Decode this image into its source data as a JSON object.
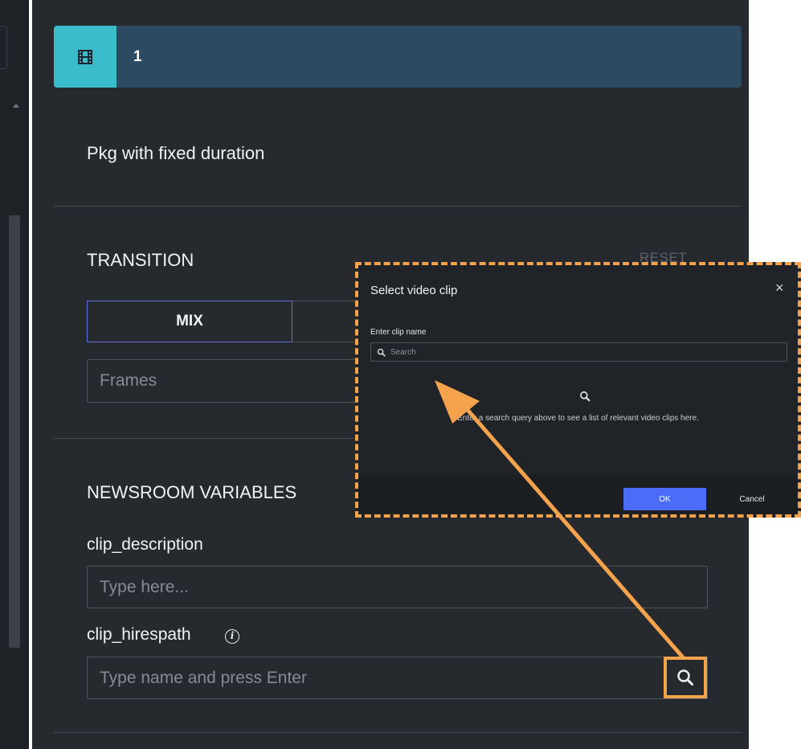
{
  "clip_header": {
    "icon": "film-icon",
    "number": "1"
  },
  "clip_title": "Pkg with fixed duration",
  "transition": {
    "title": "TRANSITION",
    "reset_label": "RESET",
    "mix_label": "MIX",
    "frames_placeholder": "Frames"
  },
  "newsroom": {
    "title": "NEWSROOM VARIABLES",
    "clip_description": {
      "label": "clip_description",
      "placeholder": "Type here..."
    },
    "clip_hirespath": {
      "label": "clip_hirespath",
      "info_icon": "info-icon",
      "info_glyph": "i",
      "placeholder": "Type name and press Enter",
      "search_icon": "search-icon"
    }
  },
  "dialog": {
    "title": "Select video clip",
    "close_glyph": "×",
    "field_label": "Enter clip name",
    "search_placeholder": "Search",
    "empty_text": "Enter a search query above to see a list of relevant video clips here.",
    "ok_label": "OK",
    "cancel_label": "Cancel"
  },
  "colors": {
    "panel_bg": "#262a2e",
    "header_bg": "#2c4a62",
    "header_icon_bg": "#3bbccb",
    "accent_blue": "#4a6cf7",
    "highlight_orange": "#f4a24b"
  }
}
